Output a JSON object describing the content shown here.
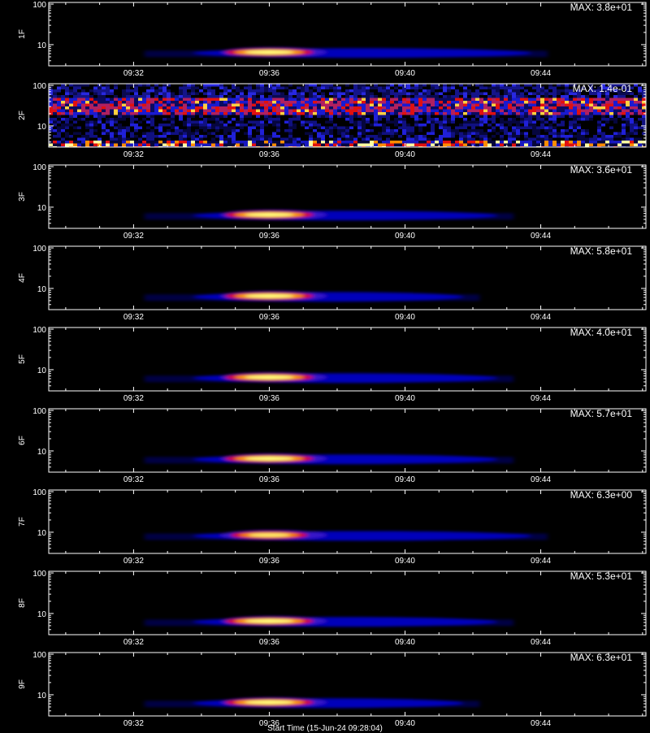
{
  "chart_data": [
    {
      "type": "heatmap",
      "ylabel": "1F",
      "max_label": "MAX: 3.8e+01",
      "peak_value": 38.0,
      "x_ticks": [
        "09:32",
        "09:36",
        "09:40",
        "09:44"
      ],
      "y_ticks": [
        "10",
        "100"
      ],
      "y_scale": "log",
      "ylim": [
        3,
        110
      ],
      "burst": {
        "start": "09:34",
        "peak": "09:36",
        "end": "09:43",
        "center_y": 6.5,
        "peak_fraction": 1.0
      }
    },
    {
      "type": "heatmap",
      "ylabel": "2F",
      "max_label": "MAX: 1.4e-01",
      "peak_value": 0.14,
      "x_ticks": [
        "09:32",
        "09:36",
        "09:40",
        "09:44"
      ],
      "y_ticks": [
        "10",
        "100"
      ],
      "y_scale": "log",
      "ylim": [
        3,
        110
      ],
      "noise": {
        "band_y": 33,
        "bottom_hot": true
      }
    },
    {
      "type": "heatmap",
      "ylabel": "3F",
      "max_label": "MAX: 3.6e+01",
      "peak_value": 36.0,
      "x_ticks": [
        "09:32",
        "09:36",
        "09:40",
        "09:44"
      ],
      "y_ticks": [
        "10",
        "100"
      ],
      "y_scale": "log",
      "ylim": [
        3,
        110
      ],
      "burst": {
        "start": "09:34",
        "peak": "09:36",
        "end": "09:42",
        "center_y": 6.5,
        "peak_fraction": 1.0
      }
    },
    {
      "type": "heatmap",
      "ylabel": "4F",
      "max_label": "MAX: 5.8e+01",
      "peak_value": 58.0,
      "x_ticks": [
        "09:32",
        "09:36",
        "09:40",
        "09:44"
      ],
      "y_ticks": [
        "10",
        "100"
      ],
      "y_scale": "log",
      "ylim": [
        3,
        110
      ],
      "burst": {
        "start": "09:34",
        "peak": "09:36",
        "end": "09:41",
        "center_y": 6.5,
        "peak_fraction": 1.0
      }
    },
    {
      "type": "heatmap",
      "ylabel": "5F",
      "max_label": "MAX: 4.0e+01",
      "peak_value": 40.0,
      "x_ticks": [
        "09:32",
        "09:36",
        "09:40",
        "09:44"
      ],
      "y_ticks": [
        "10",
        "100"
      ],
      "y_scale": "log",
      "ylim": [
        3,
        110
      ],
      "burst": {
        "start": "09:34",
        "peak": "09:36",
        "end": "09:42",
        "center_y": 6.5,
        "peak_fraction": 1.0
      }
    },
    {
      "type": "heatmap",
      "ylabel": "6F",
      "max_label": "MAX: 5.7e+01",
      "peak_value": 57.0,
      "x_ticks": [
        "09:32",
        "09:36",
        "09:40",
        "09:44"
      ],
      "y_ticks": [
        "10",
        "100"
      ],
      "y_scale": "log",
      "ylim": [
        3,
        110
      ],
      "burst": {
        "start": "09:34",
        "peak": "09:36",
        "end": "09:42",
        "center_y": 6.5,
        "peak_fraction": 1.0
      }
    },
    {
      "type": "heatmap",
      "ylabel": "7F",
      "max_label": "MAX: 6.3e+00",
      "peak_value": 6.3,
      "x_ticks": [
        "09:32",
        "09:36",
        "09:40",
        "09:44"
      ],
      "y_ticks": [
        "10",
        "100"
      ],
      "y_scale": "log",
      "ylim": [
        3,
        110
      ],
      "burst": {
        "start": "09:34",
        "peak": "09:36",
        "end": "09:43",
        "center_y": 8.5,
        "peak_fraction": 0.85
      }
    },
    {
      "type": "heatmap",
      "ylabel": "8F",
      "max_label": "MAX: 5.3e+01",
      "peak_value": 53.0,
      "x_ticks": [
        "09:32",
        "09:36",
        "09:40",
        "09:44"
      ],
      "y_ticks": [
        "10",
        "100"
      ],
      "y_scale": "log",
      "ylim": [
        3,
        110
      ],
      "burst": {
        "start": "09:34",
        "peak": "09:36",
        "end": "09:42",
        "center_y": 6.5,
        "peak_fraction": 1.0
      }
    },
    {
      "type": "heatmap",
      "ylabel": "9F",
      "max_label": "MAX: 6.3e+01",
      "peak_value": 63.0,
      "x_ticks": [
        "09:32",
        "09:36",
        "09:40",
        "09:44"
      ],
      "y_ticks": [
        "10",
        "100"
      ],
      "y_scale": "log",
      "ylim": [
        3,
        110
      ],
      "burst": {
        "start": "09:34",
        "peak": "09:36",
        "end": "09:41",
        "center_y": 6.5,
        "peak_fraction": 1.0
      }
    }
  ],
  "x_axis_title": "Start Time (15-Jun-24 09:28:04)",
  "colors": {
    "background": "#000000",
    "axis": "#ffffff",
    "low": "#0000c8",
    "mid": "#e00000",
    "high": "#ffff80"
  }
}
